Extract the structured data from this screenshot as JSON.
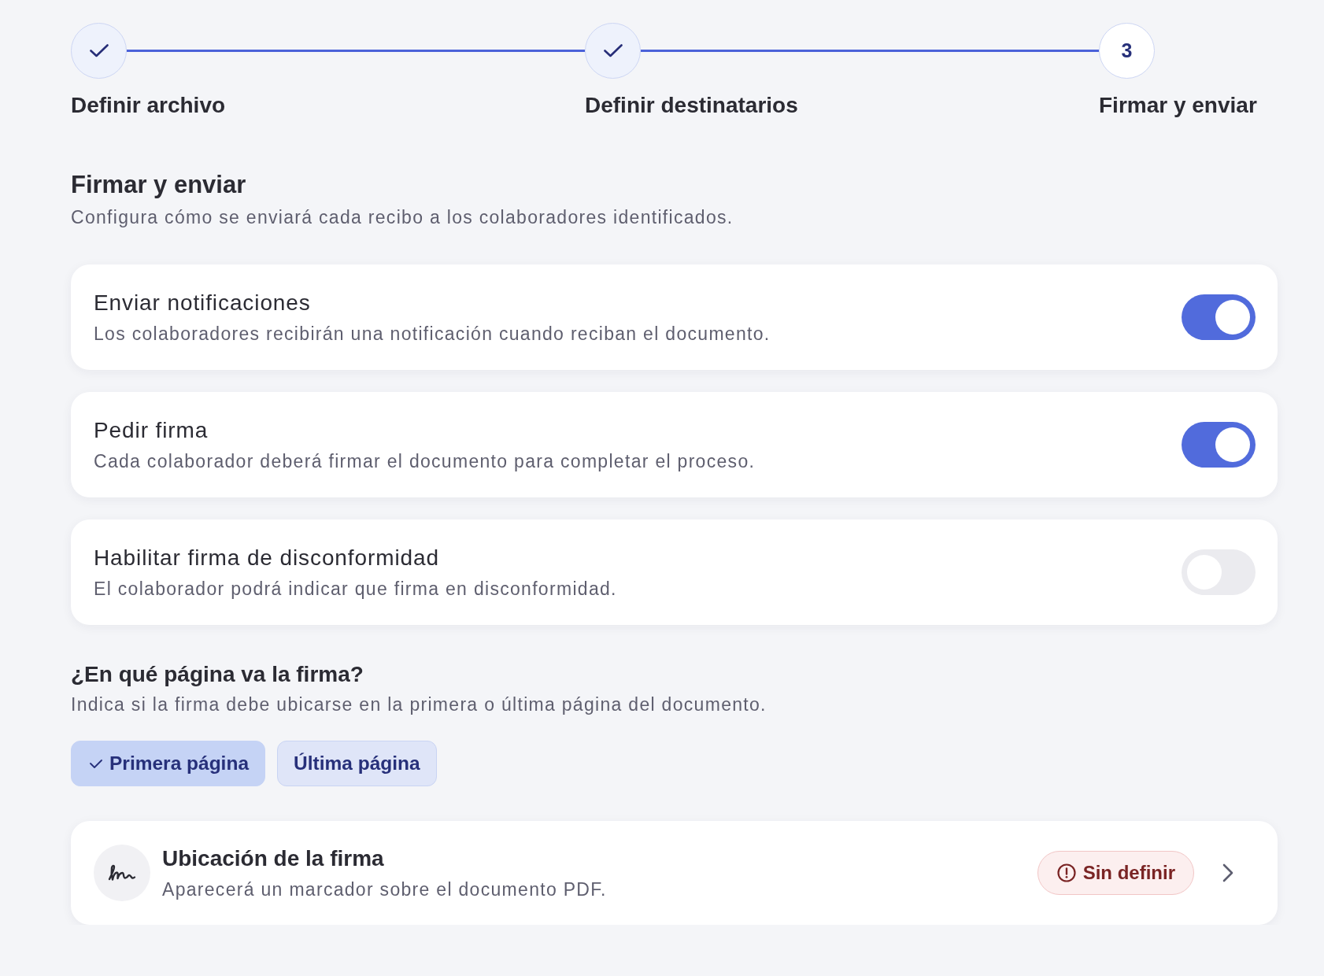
{
  "stepper": {
    "steps": [
      {
        "label": "Definir archivo",
        "completed": true
      },
      {
        "label": "Definir destinatarios",
        "completed": true
      },
      {
        "label": "Firmar y enviar",
        "completed": false,
        "number": "3"
      }
    ]
  },
  "header": {
    "title": "Firmar y enviar",
    "subtitle": "Configura cómo se enviará cada recibo a los colaboradores identificados."
  },
  "settings": [
    {
      "title": "Enviar notificaciones",
      "description": "Los colaboradores recibirán una notificación cuando reciban el documento.",
      "on": true
    },
    {
      "title": "Pedir firma",
      "description": "Cada colaborador deberá firmar el documento para completar el proceso.",
      "on": true
    },
    {
      "title": "Habilitar firma de disconformidad",
      "description": "El colaborador podrá indicar que firma en disconformidad.",
      "on": false
    }
  ],
  "page_position": {
    "title": "¿En qué página va la firma?",
    "description": "Indica si la firma debe ubicarse en la primera o última página del documento.",
    "options": [
      {
        "label": "Primera página",
        "selected": true
      },
      {
        "label": "Última página",
        "selected": false
      }
    ]
  },
  "signature_location": {
    "title": "Ubicación de la firma",
    "description": "Aparecerá un marcador sobre el documento PDF.",
    "status": "Sin definir"
  }
}
